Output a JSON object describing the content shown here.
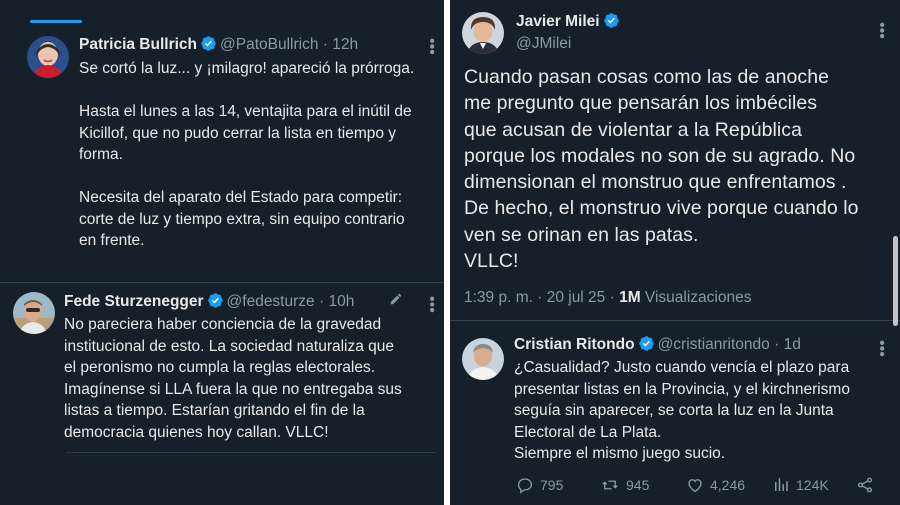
{
  "tweets": {
    "bullrich": {
      "name": "Patricia Bullrich",
      "handle": "@PatoBullrich",
      "time": "12h",
      "text": "Se cortó la luz... y ¡milagro! apareció la prórroga.\n\nHasta el lunes a las 14, ventajita para el inútil de\nKicillof, que no pudo cerrar la lista en tiempo y\nforma.\n\nNecesita del aparato del Estado para competir:\ncorte de luz y tiempo extra, sin equipo contrario\nen frente."
    },
    "sturzenegger": {
      "name": "Fede Sturzenegger",
      "handle": "@fedesturze",
      "time": "10h",
      "text": "No pareciera haber conciencia de la gravedad\ninstitucional de esto. La sociedad naturaliza que\nel peronismo no cumpla la reglas electorales.\nImagínense si LLA fuera la que no entregaba sus\nlistas a tiempo. Estarían gritando el fin de la\ndemocracia quienes hoy callan. VLLC!"
    },
    "milei": {
      "name": "Javier Milei",
      "handle": "@JMilei",
      "text": "Cuando pasan cosas como las de anoche\nme pregunto que pensarán los imbéciles\nque acusan de violentar a la República\nporque los modales no son de su agrado. No\ndimensionan el monstruo que enfrentamos .\nDe hecho, el monstruo vive porque cuando lo\nven se orinan en las patas.\nVLLC!",
      "timestamp": "1:39 p. m. · 20 jul 25 · ",
      "views_count": "1M",
      "views_label": " Visualizaciones"
    },
    "ritondo": {
      "name": "Cristian Ritondo",
      "handle": "@cristianritondo",
      "time": "1d",
      "text": "¿Casualidad? Justo cuando vencía el plazo para\npresentar listas en la Provincia, y el kirchnerismo\nseguía sin aparecer, se corta la luz en la Junta\nElectoral de La Plata.\nSiempre el mismo juego sucio.",
      "replies": "795",
      "reposts": "945",
      "likes": "4,246",
      "views": "124K"
    }
  },
  "separator_dot": "·",
  "colors": {
    "background": "#15202b",
    "verified": "#1d9bf0",
    "muted": "#8b98a5",
    "text": "#e7e9ea"
  },
  "icons": [
    "verified-badge-icon",
    "more-options-icon",
    "edit-pencil-icon",
    "reply-icon",
    "repost-icon",
    "like-icon",
    "views-icon",
    "share-icon"
  ]
}
